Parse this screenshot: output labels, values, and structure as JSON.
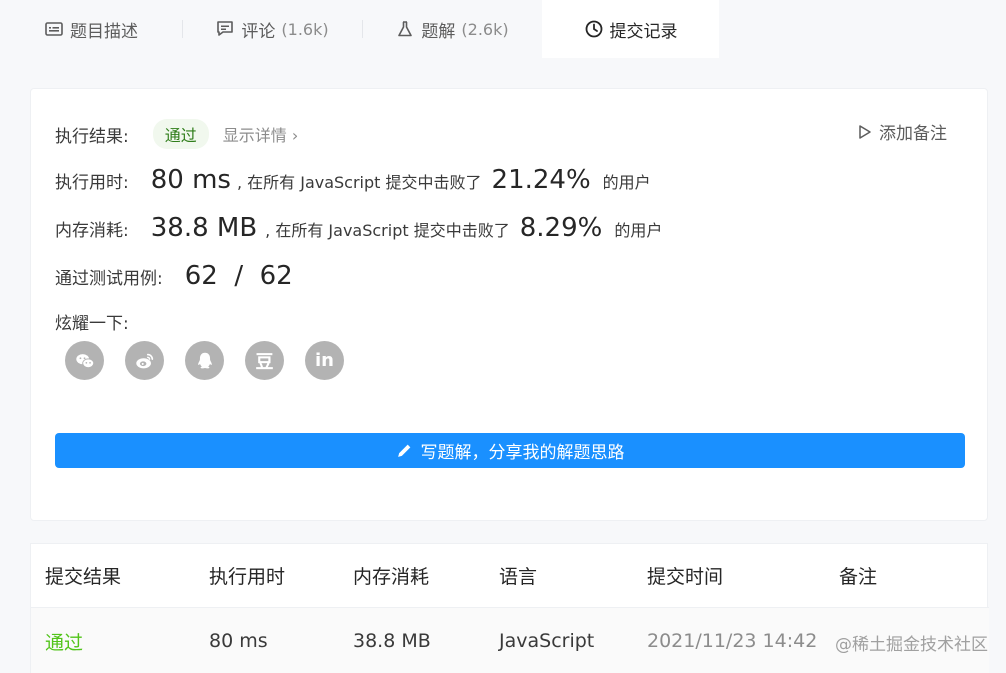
{
  "tabs": [
    {
      "label": "题目描述",
      "count": "",
      "icon": "description-icon"
    },
    {
      "label": "评论",
      "count": "(1.6k)",
      "icon": "comment-icon"
    },
    {
      "label": "题解",
      "count": "(2.6k)",
      "icon": "flask-icon"
    },
    {
      "label": "提交记录",
      "count": "",
      "icon": "clock-icon"
    }
  ],
  "result": {
    "status_label": "执行结果:",
    "status": "通过",
    "show_detail": "显示详情 ›",
    "add_note": "添加备注",
    "runtime_label": "执行用时:",
    "runtime_value": "80 ms",
    "runtime_text": ", 在所有 JavaScript 提交中击败了",
    "runtime_percent": "21.24%",
    "runtime_suffix": "的用户",
    "memory_label": "内存消耗:",
    "memory_value": "38.8 MB",
    "memory_text": ", 在所有 JavaScript 提交中击败了",
    "memory_percent": "8.29%",
    "memory_suffix": "的用户",
    "tests_label": "通过测试用例:",
    "tests_value": "62  /  62",
    "share_label": "炫耀一下:",
    "share_icons": [
      "wechat-icon",
      "weibo-icon",
      "qq-icon",
      "douban-icon",
      "linkedin-icon"
    ],
    "douban_glyph": "豆",
    "linkedin_glyph": "in",
    "write_button": "写题解，分享我的解题思路"
  },
  "table": {
    "headers": [
      "提交结果",
      "执行用时",
      "内存消耗",
      "语言",
      "提交时间",
      "备注"
    ],
    "rows": [
      [
        "通过",
        "80 ms",
        "38.8 MB",
        "JavaScript",
        "2021/11/23 14:42",
        ""
      ]
    ]
  },
  "watermark": "@稀土掘金技术社区",
  "colors": {
    "accent": "#1a90ff",
    "success": "#52c41a",
    "badge_bg": "#f1f8ee"
  }
}
